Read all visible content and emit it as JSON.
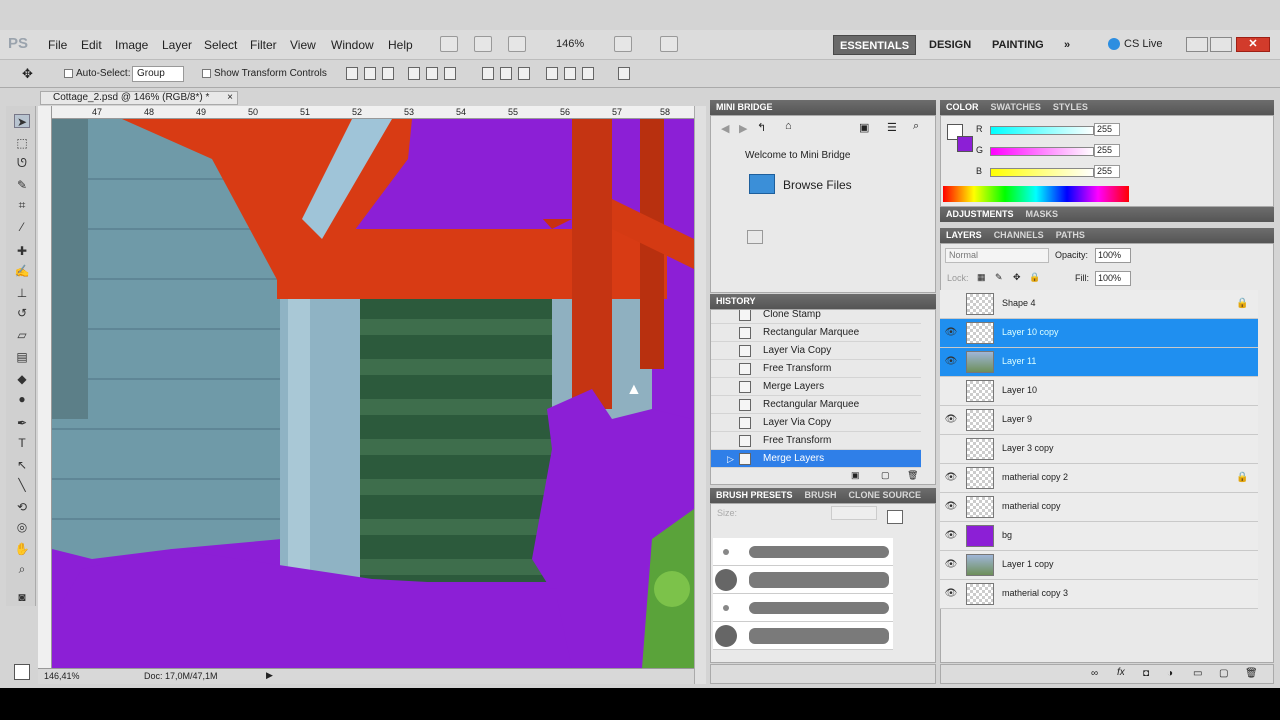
{
  "app": {
    "logo": "PS"
  },
  "menu": [
    "File",
    "Edit",
    "Image",
    "Layer",
    "Select",
    "Filter",
    "View",
    "Window",
    "Help"
  ],
  "zoom_select": "146%",
  "workspaces": {
    "essentials": "ESSENTIALS",
    "design": "DESIGN",
    "painting": "PAINTING",
    "more": "»"
  },
  "cslive": "CS Live",
  "options": {
    "auto_select": "Auto-Select:",
    "group": "Group",
    "transform": "Show Transform Controls"
  },
  "document": {
    "tab": "Cottage_2.psd @ 146% (RGB/8*) *",
    "zoom": "146,41%",
    "doc_size": "Doc: 17,0M/47,1M"
  },
  "ruler_ticks": [
    "47",
    "48",
    "49",
    "50",
    "51",
    "52",
    "53",
    "54",
    "55",
    "56",
    "57",
    "58"
  ],
  "minibridge": {
    "title": "MINI BRIDGE",
    "welcome": "Welcome to Mini Bridge",
    "browse": "Browse Files"
  },
  "history": {
    "title": "HISTORY",
    "items": [
      "Clone Stamp",
      "Rectangular Marquee",
      "Layer Via Copy",
      "Free Transform",
      "Merge Layers",
      "Rectangular Marquee",
      "Layer Via Copy",
      "Free Transform",
      "Merge Layers"
    ]
  },
  "brush": {
    "tab1": "BRUSH PRESETS",
    "tab2": "BRUSH",
    "tab3": "CLONE SOURCE",
    "size_label": "Size:"
  },
  "color": {
    "tabs": [
      "COLOR",
      "SWATCHES",
      "STYLES"
    ],
    "channels": [
      {
        "name": "R",
        "value": "255"
      },
      {
        "name": "G",
        "value": "255"
      },
      {
        "name": "B",
        "value": "255"
      }
    ]
  },
  "adjust_tabs": [
    "ADJUSTMENTS",
    "MASKS"
  ],
  "layers_tabs": [
    "LAYERS",
    "CHANNELS",
    "PATHS"
  ],
  "layers_opts": {
    "mode": "Normal",
    "opacity_label": "Opacity:",
    "opacity": "100%",
    "lock_label": "Lock:",
    "fill_label": "Fill:",
    "fill": "100%"
  },
  "layers": [
    {
      "name": "Shape 4",
      "visible": false,
      "locked": true,
      "selected": false
    },
    {
      "name": "Layer 10 copy",
      "visible": true,
      "locked": false,
      "selected": true
    },
    {
      "name": "Layer 11",
      "visible": true,
      "locked": false,
      "selected": true
    },
    {
      "name": "Layer 10",
      "visible": false,
      "locked": false,
      "selected": false
    },
    {
      "name": "Layer 9",
      "visible": true,
      "locked": false,
      "selected": false
    },
    {
      "name": "Layer 3 copy",
      "visible": false,
      "locked": false,
      "selected": false
    },
    {
      "name": "matherial copy 2",
      "visible": true,
      "locked": true,
      "selected": false
    },
    {
      "name": "matherial copy",
      "visible": true,
      "locked": false,
      "selected": false
    },
    {
      "name": "bg",
      "visible": true,
      "locked": false,
      "selected": false
    },
    {
      "name": "Layer 1 copy",
      "visible": true,
      "locked": false,
      "selected": false
    },
    {
      "name": "matherial copy 3",
      "visible": true,
      "locked": false,
      "selected": false
    }
  ],
  "colors": {
    "accent": "#2f7fe8",
    "canvas_purple": "#8c1fd6",
    "beam_red": "#d83b14",
    "wall_blue": "#7ea6b8"
  }
}
